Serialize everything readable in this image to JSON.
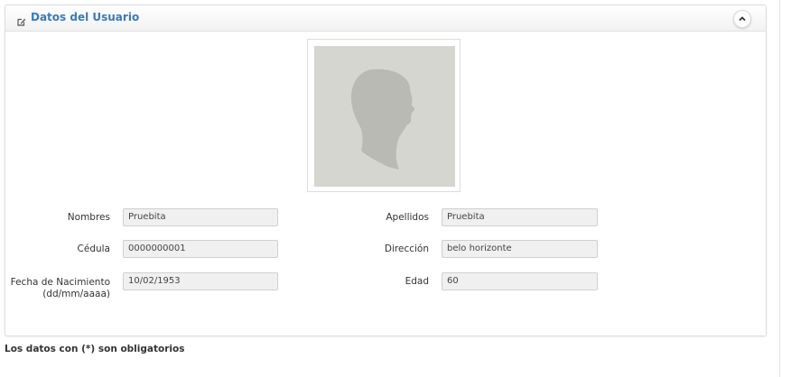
{
  "panel": {
    "title": "Datos del Usuario",
    "header_icon": "edit-icon",
    "collapse_icon": "chevron-up-icon",
    "photo_icon": "profile-silhouette-icon"
  },
  "form": {
    "nombres_label": "Nombres",
    "nombres_value": "Pruebita",
    "apellidos_label": "Apellidos",
    "apellidos_value": "Pruebita",
    "cedula_label": "Cédula",
    "cedula_value": "0000000001",
    "direccion_label": "Dirección",
    "direccion_value": "belo horizonte",
    "fecha_label_line1": "Fecha de Nacimiento",
    "fecha_label_line2": "(dd/mm/aaaa)",
    "fecha_value": "10/02/1953",
    "edad_label": "Edad",
    "edad_value": "60"
  },
  "footer": {
    "required_note": "Los datos con (*) son obligatorios"
  },
  "colors": {
    "title_accent": "#3a7bb8",
    "field_background": "#f0f0f0",
    "photo_background": "#d5d6d0",
    "silhouette": "#b9bab3"
  }
}
